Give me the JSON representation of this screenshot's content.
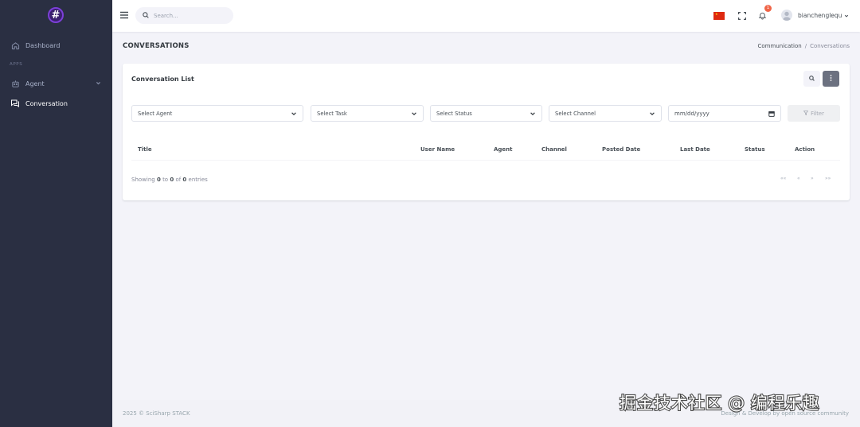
{
  "logo": {
    "symbol": "#"
  },
  "sidebar": {
    "section_apps": "APPS",
    "items": [
      {
        "label": "Dashboard"
      },
      {
        "label": "Agent"
      },
      {
        "label": "Conversation"
      }
    ]
  },
  "topbar": {
    "search_placeholder": "Search...",
    "notification_count": "1",
    "username": "bianchenglequ"
  },
  "page": {
    "title": "CONVERSATIONS",
    "breadcrumb": [
      "Communication",
      "/",
      "Conversations"
    ]
  },
  "card": {
    "title": "Conversation List",
    "filters": {
      "agent": "Select Agent",
      "task": "Select Task",
      "status": "Select Status",
      "channel": "Select Channel",
      "date": "mm/dd/yyyy",
      "filter_button": "Filter"
    },
    "columns": [
      "Title",
      "User Name",
      "Agent",
      "Channel",
      "Posted Date",
      "Last Date",
      "Status",
      "Action"
    ],
    "showing": {
      "prefix": "Showing",
      "from": "0",
      "to_word": "to",
      "to": "0",
      "of_word": "of",
      "total": "0",
      "suffix": "entries"
    },
    "pager": [
      "««",
      "«",
      "»",
      "»»"
    ]
  },
  "footer": {
    "left": "2025 © SciSharp STACK",
    "right": "Design & Develop by open source community"
  },
  "watermark": {
    "text": "掘金技术社区 @ 编程乐趣"
  },
  "colors": {
    "sidebar_bg": "#2a2f42",
    "page_bg": "#f3f3f9",
    "badge": "#f06548",
    "logo_ring": "#7c3fd8"
  },
  "icons": [
    "hash-logo-icon",
    "home-icon",
    "agent-icon",
    "conversation-icon",
    "menu-icon",
    "search-icon",
    "cn-flag-icon",
    "fullscreen-icon",
    "bell-icon",
    "user-avatar-icon",
    "more-vertical-icon",
    "calendar-icon",
    "filter-icon",
    "chevron-down-icon"
  ]
}
